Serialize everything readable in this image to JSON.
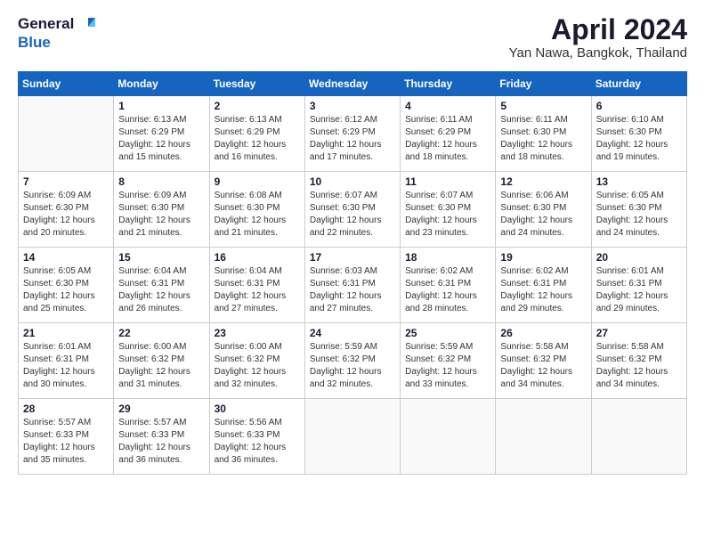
{
  "logo": {
    "general": "General",
    "blue": "Blue"
  },
  "header": {
    "month": "April 2024",
    "location": "Yan Nawa, Bangkok, Thailand"
  },
  "weekdays": [
    "Sunday",
    "Monday",
    "Tuesday",
    "Wednesday",
    "Thursday",
    "Friday",
    "Saturday"
  ],
  "weeks": [
    [
      {
        "day": "",
        "sunrise": "",
        "sunset": "",
        "daylight": ""
      },
      {
        "day": "1",
        "sunrise": "Sunrise: 6:13 AM",
        "sunset": "Sunset: 6:29 PM",
        "daylight": "Daylight: 12 hours and 15 minutes."
      },
      {
        "day": "2",
        "sunrise": "Sunrise: 6:13 AM",
        "sunset": "Sunset: 6:29 PM",
        "daylight": "Daylight: 12 hours and 16 minutes."
      },
      {
        "day": "3",
        "sunrise": "Sunrise: 6:12 AM",
        "sunset": "Sunset: 6:29 PM",
        "daylight": "Daylight: 12 hours and 17 minutes."
      },
      {
        "day": "4",
        "sunrise": "Sunrise: 6:11 AM",
        "sunset": "Sunset: 6:29 PM",
        "daylight": "Daylight: 12 hours and 18 minutes."
      },
      {
        "day": "5",
        "sunrise": "Sunrise: 6:11 AM",
        "sunset": "Sunset: 6:30 PM",
        "daylight": "Daylight: 12 hours and 18 minutes."
      },
      {
        "day": "6",
        "sunrise": "Sunrise: 6:10 AM",
        "sunset": "Sunset: 6:30 PM",
        "daylight": "Daylight: 12 hours and 19 minutes."
      }
    ],
    [
      {
        "day": "7",
        "sunrise": "Sunrise: 6:09 AM",
        "sunset": "Sunset: 6:30 PM",
        "daylight": "Daylight: 12 hours and 20 minutes."
      },
      {
        "day": "8",
        "sunrise": "Sunrise: 6:09 AM",
        "sunset": "Sunset: 6:30 PM",
        "daylight": "Daylight: 12 hours and 21 minutes."
      },
      {
        "day": "9",
        "sunrise": "Sunrise: 6:08 AM",
        "sunset": "Sunset: 6:30 PM",
        "daylight": "Daylight: 12 hours and 21 minutes."
      },
      {
        "day": "10",
        "sunrise": "Sunrise: 6:07 AM",
        "sunset": "Sunset: 6:30 PM",
        "daylight": "Daylight: 12 hours and 22 minutes."
      },
      {
        "day": "11",
        "sunrise": "Sunrise: 6:07 AM",
        "sunset": "Sunset: 6:30 PM",
        "daylight": "Daylight: 12 hours and 23 minutes."
      },
      {
        "day": "12",
        "sunrise": "Sunrise: 6:06 AM",
        "sunset": "Sunset: 6:30 PM",
        "daylight": "Daylight: 12 hours and 24 minutes."
      },
      {
        "day": "13",
        "sunrise": "Sunrise: 6:05 AM",
        "sunset": "Sunset: 6:30 PM",
        "daylight": "Daylight: 12 hours and 24 minutes."
      }
    ],
    [
      {
        "day": "14",
        "sunrise": "Sunrise: 6:05 AM",
        "sunset": "Sunset: 6:30 PM",
        "daylight": "Daylight: 12 hours and 25 minutes."
      },
      {
        "day": "15",
        "sunrise": "Sunrise: 6:04 AM",
        "sunset": "Sunset: 6:31 PM",
        "daylight": "Daylight: 12 hours and 26 minutes."
      },
      {
        "day": "16",
        "sunrise": "Sunrise: 6:04 AM",
        "sunset": "Sunset: 6:31 PM",
        "daylight": "Daylight: 12 hours and 27 minutes."
      },
      {
        "day": "17",
        "sunrise": "Sunrise: 6:03 AM",
        "sunset": "Sunset: 6:31 PM",
        "daylight": "Daylight: 12 hours and 27 minutes."
      },
      {
        "day": "18",
        "sunrise": "Sunrise: 6:02 AM",
        "sunset": "Sunset: 6:31 PM",
        "daylight": "Daylight: 12 hours and 28 minutes."
      },
      {
        "day": "19",
        "sunrise": "Sunrise: 6:02 AM",
        "sunset": "Sunset: 6:31 PM",
        "daylight": "Daylight: 12 hours and 29 minutes."
      },
      {
        "day": "20",
        "sunrise": "Sunrise: 6:01 AM",
        "sunset": "Sunset: 6:31 PM",
        "daylight": "Daylight: 12 hours and 29 minutes."
      }
    ],
    [
      {
        "day": "21",
        "sunrise": "Sunrise: 6:01 AM",
        "sunset": "Sunset: 6:31 PM",
        "daylight": "Daylight: 12 hours and 30 minutes."
      },
      {
        "day": "22",
        "sunrise": "Sunrise: 6:00 AM",
        "sunset": "Sunset: 6:32 PM",
        "daylight": "Daylight: 12 hours and 31 minutes."
      },
      {
        "day": "23",
        "sunrise": "Sunrise: 6:00 AM",
        "sunset": "Sunset: 6:32 PM",
        "daylight": "Daylight: 12 hours and 32 minutes."
      },
      {
        "day": "24",
        "sunrise": "Sunrise: 5:59 AM",
        "sunset": "Sunset: 6:32 PM",
        "daylight": "Daylight: 12 hours and 32 minutes."
      },
      {
        "day": "25",
        "sunrise": "Sunrise: 5:59 AM",
        "sunset": "Sunset: 6:32 PM",
        "daylight": "Daylight: 12 hours and 33 minutes."
      },
      {
        "day": "26",
        "sunrise": "Sunrise: 5:58 AM",
        "sunset": "Sunset: 6:32 PM",
        "daylight": "Daylight: 12 hours and 34 minutes."
      },
      {
        "day": "27",
        "sunrise": "Sunrise: 5:58 AM",
        "sunset": "Sunset: 6:32 PM",
        "daylight": "Daylight: 12 hours and 34 minutes."
      }
    ],
    [
      {
        "day": "28",
        "sunrise": "Sunrise: 5:57 AM",
        "sunset": "Sunset: 6:33 PM",
        "daylight": "Daylight: 12 hours and 35 minutes."
      },
      {
        "day": "29",
        "sunrise": "Sunrise: 5:57 AM",
        "sunset": "Sunset: 6:33 PM",
        "daylight": "Daylight: 12 hours and 36 minutes."
      },
      {
        "day": "30",
        "sunrise": "Sunrise: 5:56 AM",
        "sunset": "Sunset: 6:33 PM",
        "daylight": "Daylight: 12 hours and 36 minutes."
      },
      {
        "day": "",
        "sunrise": "",
        "sunset": "",
        "daylight": ""
      },
      {
        "day": "",
        "sunrise": "",
        "sunset": "",
        "daylight": ""
      },
      {
        "day": "",
        "sunrise": "",
        "sunset": "",
        "daylight": ""
      },
      {
        "day": "",
        "sunrise": "",
        "sunset": "",
        "daylight": ""
      }
    ]
  ]
}
